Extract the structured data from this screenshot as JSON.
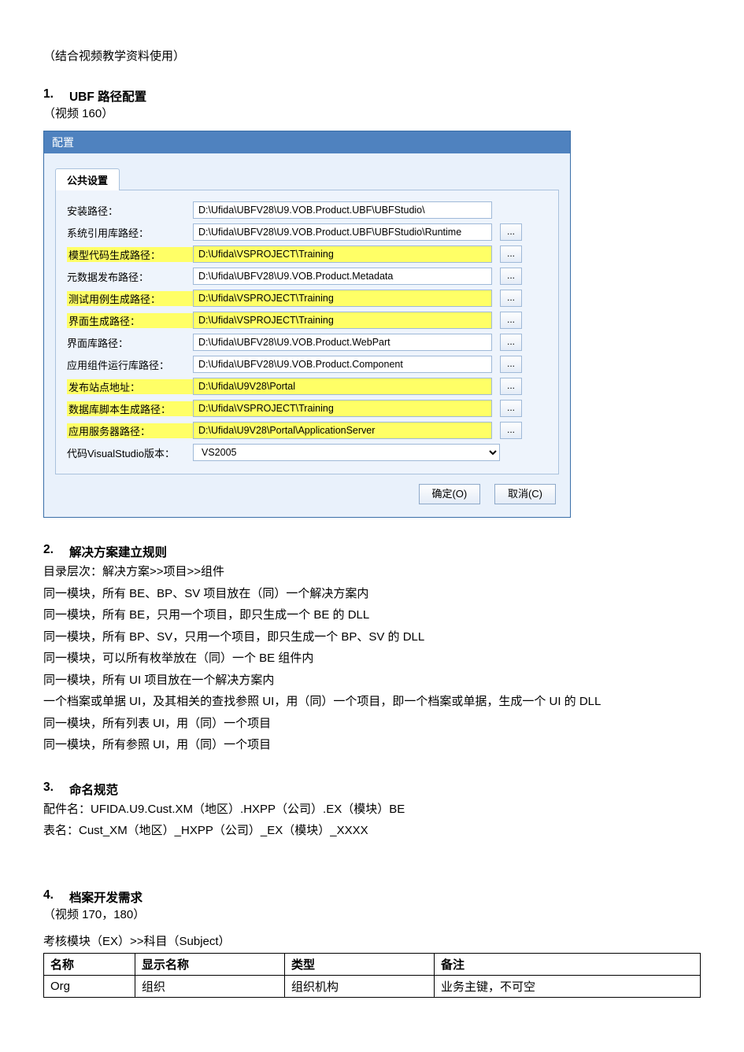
{
  "intro": "（结合视频教学资料使用）",
  "sec1": {
    "num": "1.",
    "title": "UBF 路径配置",
    "sub": "（视频 160）"
  },
  "dialog": {
    "title": "配置",
    "tab": "公共设置",
    "rows": [
      {
        "label": "安装路径：",
        "label_hl": false,
        "value": "D:\\Ufida\\UBFV28\\U9.VOB.Product.UBF\\UBFStudio\\",
        "value_hl": false,
        "browse": false
      },
      {
        "label": "系统引用库路经：",
        "label_hl": false,
        "value": "D:\\Ufida\\UBFV28\\U9.VOB.Product.UBF\\UBFStudio\\Runtime",
        "value_hl": false,
        "browse": true
      },
      {
        "label": "模型代码生成路径：",
        "label_hl": true,
        "value": "D:\\Ufida\\VSPROJECT\\Training",
        "value_hl": true,
        "browse": true
      },
      {
        "label": "元数据发布路径：",
        "label_hl": false,
        "value": "D:\\Ufida\\UBFV28\\U9.VOB.Product.Metadata",
        "value_hl": false,
        "browse": true
      },
      {
        "label": "测试用例生成路径：",
        "label_hl": true,
        "value": "D:\\Ufida\\VSPROJECT\\Training",
        "value_hl": true,
        "browse": true
      },
      {
        "label": "界面生成路径：",
        "label_hl": true,
        "value": "D:\\Ufida\\VSPROJECT\\Training",
        "value_hl": true,
        "browse": true
      },
      {
        "label": "界面库路径：",
        "label_hl": false,
        "value": "D:\\Ufida\\UBFV28\\U9.VOB.Product.WebPart",
        "value_hl": false,
        "browse": true
      },
      {
        "label": "应用组件运行库路径：",
        "label_hl": false,
        "value": "D:\\Ufida\\UBFV28\\U9.VOB.Product.Component",
        "value_hl": false,
        "browse": true
      },
      {
        "label": "发布站点地址：",
        "label_hl": true,
        "value": "D:\\Ufida\\U9V28\\Portal",
        "value_hl": true,
        "browse": true
      },
      {
        "label": "数据库脚本生成路径：",
        "label_hl": true,
        "value": "D:\\Ufida\\VSPROJECT\\Training",
        "value_hl": true,
        "browse": true
      },
      {
        "label": "应用服务器路径：",
        "label_hl": true,
        "value": "D:\\Ufida\\U9V28\\Portal\\ApplicationServer",
        "value_hl": true,
        "browse": true
      }
    ],
    "vs_label": "代码VisualStudio版本：",
    "vs_value": "VS2005",
    "browse_btn": "...",
    "ok": "确定(O)",
    "cancel": "取消(C)"
  },
  "sec2": {
    "num": "2.",
    "title": "解决方案建立规则",
    "lines": [
      "目录层次：解决方案>>项目>>组件",
      "同一模块，所有 BE、BP、SV 项目放在（同）一个解决方案内",
      "同一模块，所有 BE，只用一个项目，即只生成一个 BE 的 DLL",
      "同一模块，所有 BP、SV，只用一个项目，即只生成一个 BP、SV 的 DLL",
      "同一模块，可以所有枚举放在（同）一个 BE 组件内",
      "同一模块，所有 UI 项目放在一个解决方案内",
      "一个档案或单据 UI，及其相关的查找参照 UI，用（同）一个项目，即一个档案或单据，生成一个 UI 的 DLL",
      "同一模块，所有列表 UI，用（同）一个项目",
      "同一模块，所有参照 UI，用（同）一个项目"
    ]
  },
  "sec3": {
    "num": "3.",
    "title": "命名规范",
    "lines": [
      "配件名：UFIDA.U9.Cust.XM（地区）.HXPP（公司）.EX（模块）BE",
      "表名：Cust_XM（地区）_HXPP（公司）_EX（模块）_XXXX"
    ]
  },
  "sec4": {
    "num": "4.",
    "title": "档案开发需求",
    "sub": "（视频 170，180）",
    "line": "考核模块（EX）>>科目（Subject）",
    "table": {
      "headers": [
        "名称",
        "显示名称",
        "类型",
        "备注"
      ],
      "rows": [
        [
          "Org",
          "组织",
          "组织机构",
          "业务主键，不可空"
        ]
      ]
    }
  }
}
